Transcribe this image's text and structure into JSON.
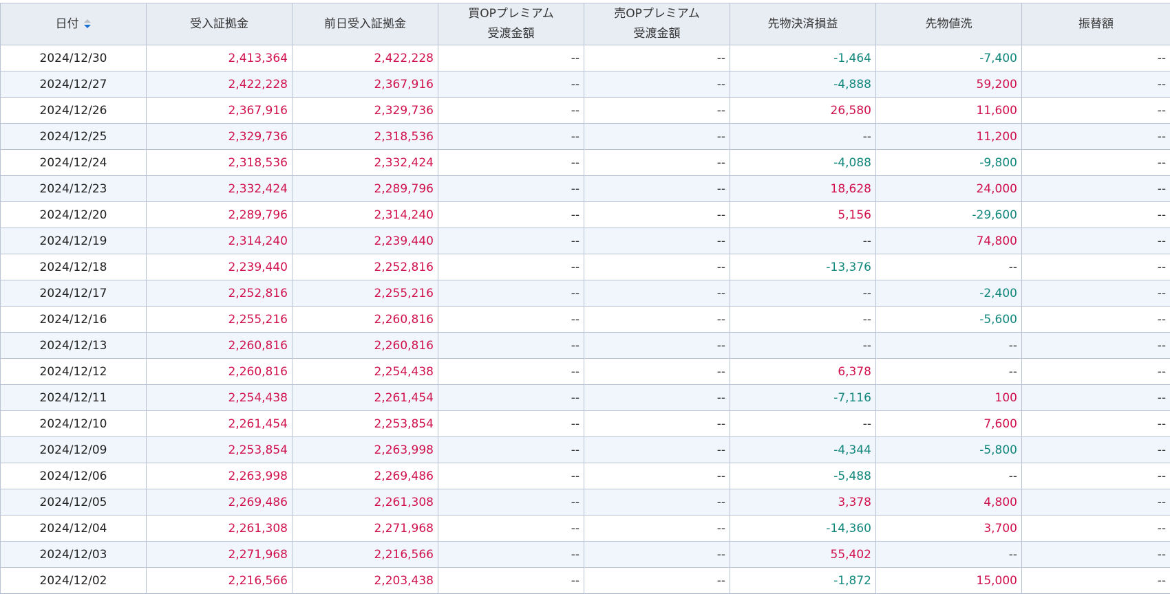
{
  "table": {
    "headers": [
      {
        "lines": [
          "日付"
        ],
        "sortable": true
      },
      {
        "lines": [
          "受入証拠金"
        ]
      },
      {
        "lines": [
          "前日受入証拠金"
        ]
      },
      {
        "lines": [
          "買OPプレミアム",
          "受渡金額"
        ]
      },
      {
        "lines": [
          "売OPプレミアム",
          "受渡金額"
        ]
      },
      {
        "lines": [
          "先物決済損益"
        ]
      },
      {
        "lines": [
          "先物値洗"
        ]
      },
      {
        "lines": [
          "振替額"
        ]
      }
    ],
    "rows": [
      [
        "2024/12/30",
        "2,413,364",
        "2,422,228",
        "--",
        "--",
        "-1,464",
        "-7,400",
        "--"
      ],
      [
        "2024/12/27",
        "2,422,228",
        "2,367,916",
        "--",
        "--",
        "-4,888",
        "59,200",
        "--"
      ],
      [
        "2024/12/26",
        "2,367,916",
        "2,329,736",
        "--",
        "--",
        "26,580",
        "11,600",
        "--"
      ],
      [
        "2024/12/25",
        "2,329,736",
        "2,318,536",
        "--",
        "--",
        "--",
        "11,200",
        "--"
      ],
      [
        "2024/12/24",
        "2,318,536",
        "2,332,424",
        "--",
        "--",
        "-4,088",
        "-9,800",
        "--"
      ],
      [
        "2024/12/23",
        "2,332,424",
        "2,289,796",
        "--",
        "--",
        "18,628",
        "24,000",
        "--"
      ],
      [
        "2024/12/20",
        "2,289,796",
        "2,314,240",
        "--",
        "--",
        "5,156",
        "-29,600",
        "--"
      ],
      [
        "2024/12/19",
        "2,314,240",
        "2,239,440",
        "--",
        "--",
        "--",
        "74,800",
        "--"
      ],
      [
        "2024/12/18",
        "2,239,440",
        "2,252,816",
        "--",
        "--",
        "-13,376",
        "--",
        "--"
      ],
      [
        "2024/12/17",
        "2,252,816",
        "2,255,216",
        "--",
        "--",
        "--",
        "-2,400",
        "--"
      ],
      [
        "2024/12/16",
        "2,255,216",
        "2,260,816",
        "--",
        "--",
        "--",
        "-5,600",
        "--"
      ],
      [
        "2024/12/13",
        "2,260,816",
        "2,260,816",
        "--",
        "--",
        "--",
        "--",
        "--"
      ],
      [
        "2024/12/12",
        "2,260,816",
        "2,254,438",
        "--",
        "--",
        "6,378",
        "--",
        "--"
      ],
      [
        "2024/12/11",
        "2,254,438",
        "2,261,454",
        "--",
        "--",
        "-7,116",
        "100",
        "--"
      ],
      [
        "2024/12/10",
        "2,261,454",
        "2,253,854",
        "--",
        "--",
        "--",
        "7,600",
        "--"
      ],
      [
        "2024/12/09",
        "2,253,854",
        "2,263,998",
        "--",
        "--",
        "-4,344",
        "-5,800",
        "--"
      ],
      [
        "2024/12/06",
        "2,263,998",
        "2,269,486",
        "--",
        "--",
        "-5,488",
        "--",
        "--"
      ],
      [
        "2024/12/05",
        "2,269,486",
        "2,261,308",
        "--",
        "--",
        "3,378",
        "4,800",
        "--"
      ],
      [
        "2024/12/04",
        "2,261,308",
        "2,271,968",
        "--",
        "--",
        "-14,360",
        "3,700",
        "--"
      ],
      [
        "2024/12/03",
        "2,271,968",
        "2,216,566",
        "--",
        "--",
        "55,402",
        "--",
        "--"
      ],
      [
        "2024/12/02",
        "2,216,566",
        "2,203,438",
        "--",
        "--",
        "-1,872",
        "15,000",
        "--"
      ]
    ]
  },
  "icons": {
    "sort": "sort-desc-icon"
  },
  "colors": {
    "positive": "#d0104c",
    "negative": "#11877b",
    "header_bg": "#e8ecf3",
    "stripe_bg": "#f1f6fc",
    "sort_active": "#1a6fd6"
  }
}
